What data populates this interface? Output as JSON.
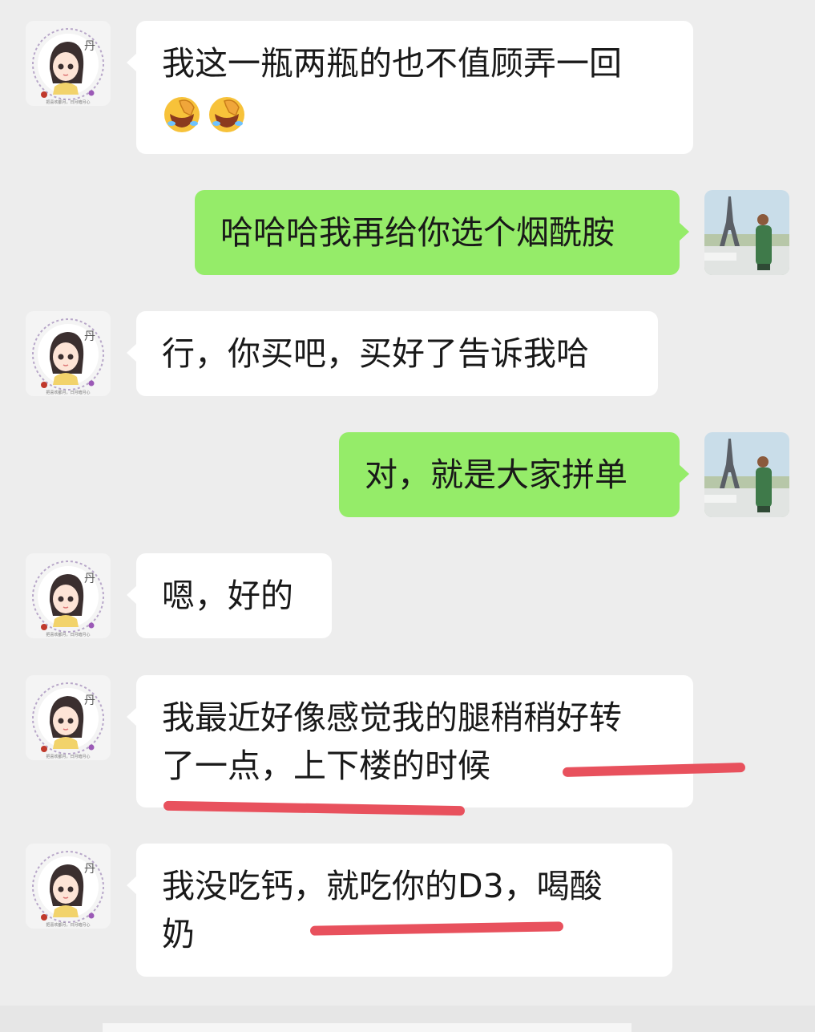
{
  "chat": {
    "messages": [
      {
        "sender": "contact",
        "lines": [
          "我这一瓶两瓶的也不值顾弄一回"
        ],
        "emojis": [
          "facepalm-laugh-emoji",
          "facepalm-laugh-emoji"
        ]
      },
      {
        "sender": "me",
        "lines": [
          "哈哈哈我再给你选个烟酰胺"
        ]
      },
      {
        "sender": "contact",
        "lines": [
          "行，你买吧，买好了告诉我哈"
        ]
      },
      {
        "sender": "me",
        "lines": [
          "对，就是大家拼单"
        ]
      },
      {
        "sender": "contact",
        "lines": [
          "嗯，好的"
        ]
      },
      {
        "sender": "contact",
        "lines": [
          "我最近好像感觉我的腿稍稍好转",
          "了一点，上下楼的时候"
        ]
      },
      {
        "sender": "contact",
        "lines": [
          "我没吃钙，就吃你的D3，喝酸",
          "奶"
        ]
      }
    ],
    "contact_avatar": {
      "badge_text": "丹",
      "caption": "把喜欢都月，日月暗月心"
    }
  },
  "colors": {
    "background": "#ededed",
    "bubble_sent": "#95ec69",
    "bubble_received": "#ffffff",
    "text": "#191919",
    "annotation_underline": "#e8515d"
  }
}
